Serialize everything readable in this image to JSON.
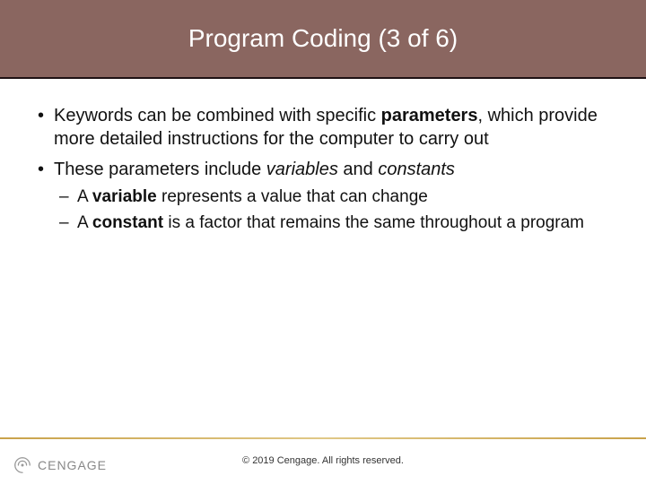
{
  "title": "Program Coding (3 of 6)",
  "bullets": {
    "b1": {
      "t1": "Keywords can be combined with specific ",
      "t2": "parameters",
      "t3": ", which provide more detailed instructions for the computer to carry out"
    },
    "b2": {
      "t1": "These parameters include ",
      "t2": "variables",
      "t3": " and ",
      "t4": "constants"
    },
    "s1": {
      "t1": "A ",
      "t2": "variable",
      "t3": " represents a value that can change"
    },
    "s2": {
      "t1": "A ",
      "t2": "constant",
      "t3": " is a factor that remains the same throughout a program"
    }
  },
  "footer": {
    "copyright": "© 2019 Cengage. All rights reserved.",
    "brand": "CENGAGE"
  }
}
